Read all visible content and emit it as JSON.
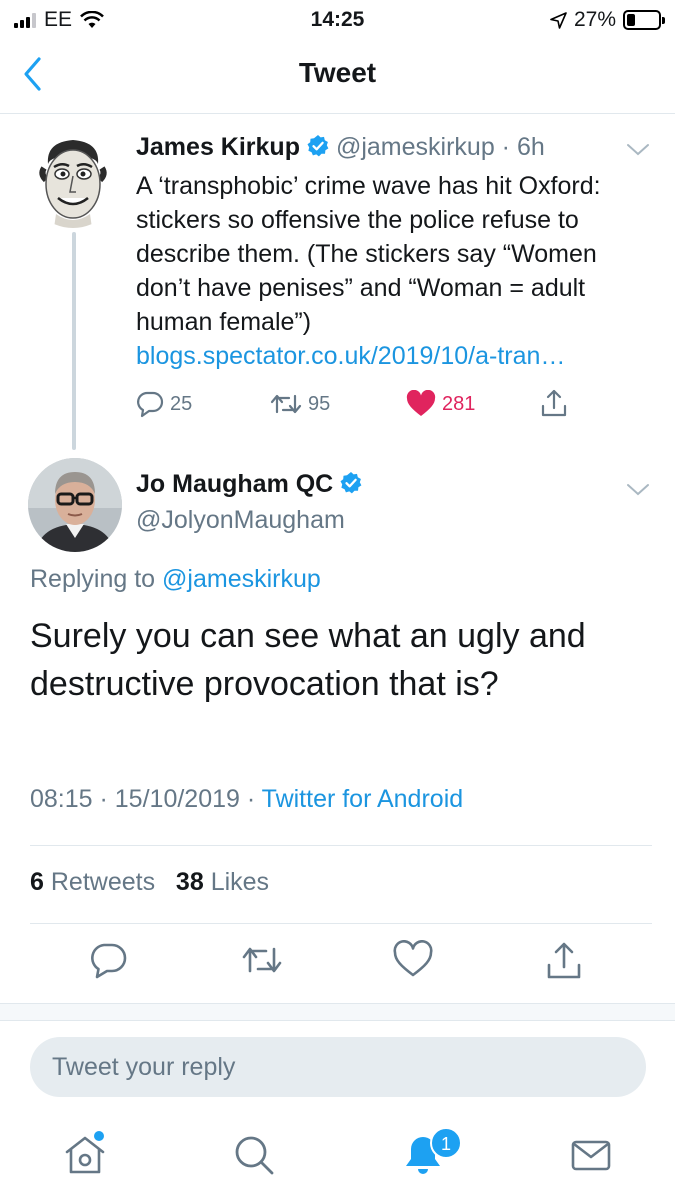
{
  "status_bar": {
    "carrier": "EE",
    "time": "14:25",
    "battery_percent": "27%",
    "battery_level": 0.27
  },
  "nav": {
    "title": "Tweet"
  },
  "quoted_tweet": {
    "author_name": "James Kirkup",
    "handle": "@jameskirkup",
    "age": "6h",
    "text": "A ‘transphobic’ crime wave has hit Oxford: stickers so offensive the police refuse to describe them.  (The stickers say “Women don’t have penises” and “Woman = adult human female”)",
    "link": "blogs.spectator.co.uk/2019/10/a-tran…",
    "replies": "25",
    "retweets": "95",
    "likes": "281",
    "liked": true
  },
  "main_tweet": {
    "author_name": "Jo Maugham QC",
    "handle": "@JolyonMaugham",
    "replying_prefix": "Replying to",
    "replying_to": "@jameskirkup",
    "text": "Surely you can see what an ugly and destructive provocation that is?",
    "time": "08:15",
    "date": "15/10/2019",
    "source": "Twitter for Android",
    "retweet_count": "6",
    "retweet_label": "Retweets",
    "like_count": "38",
    "like_label": "Likes"
  },
  "reply_box": {
    "placeholder": "Tweet your reply"
  },
  "tab_bar": {
    "notification_badge": "1",
    "tabs": [
      "home-icon",
      "search-icon",
      "notifications-icon",
      "messages-icon"
    ]
  },
  "colors": {
    "accent": "#1da1f2",
    "link": "#1b95e0",
    "muted": "#657786",
    "like": "#e0245e",
    "verified": "#1da1f2"
  }
}
